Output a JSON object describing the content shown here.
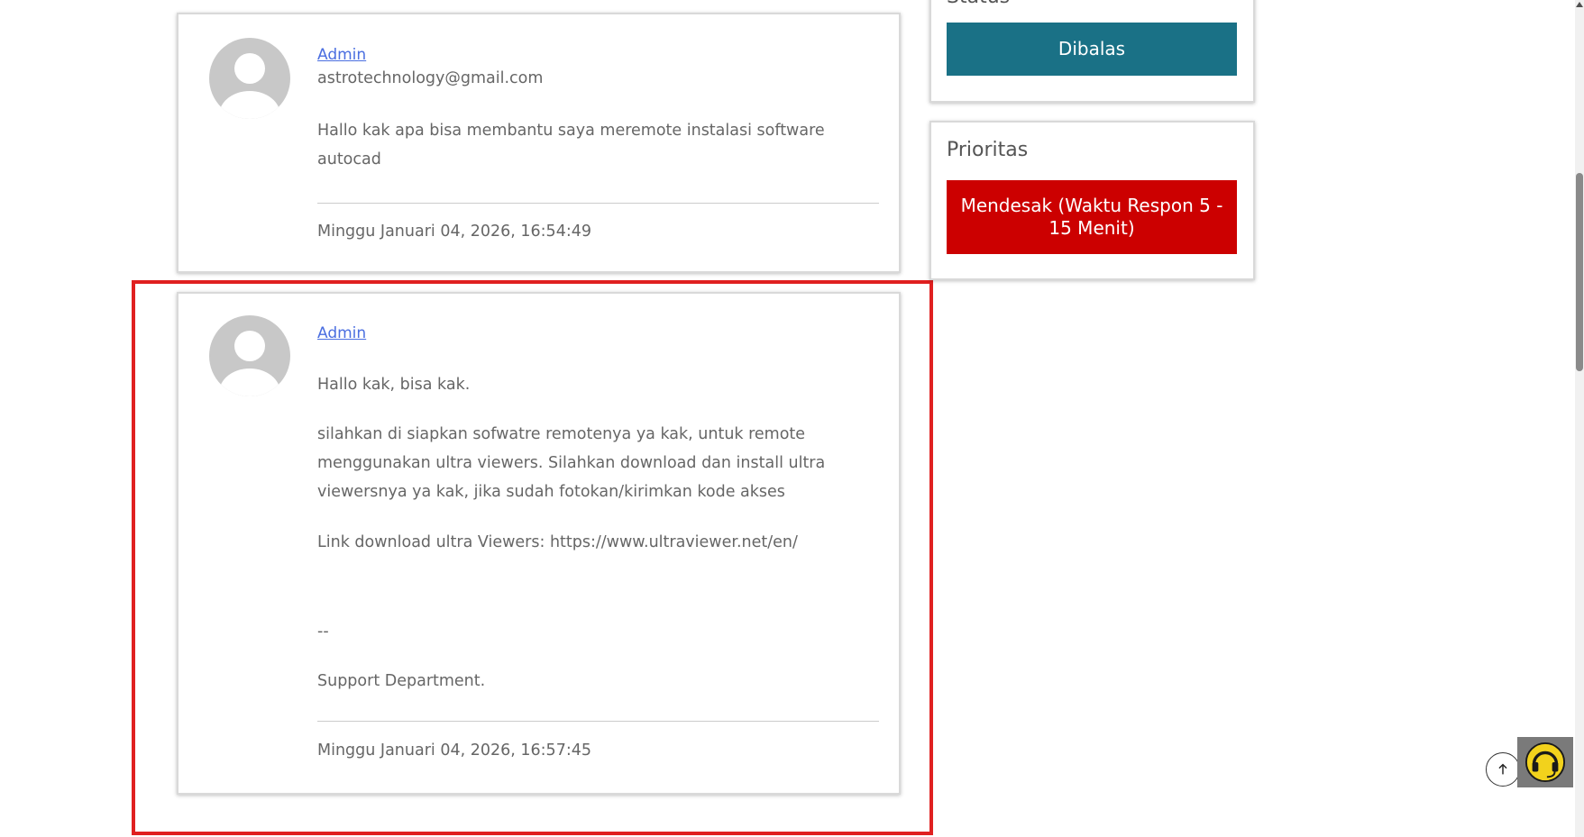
{
  "sidebar": {
    "status_title": "Status",
    "status_value": "Dibalas",
    "priority_title": "Prioritas",
    "priority_value": "Mendesak (Waktu Respon 5 - 15 Menit)"
  },
  "messages": [
    {
      "author": "Admin",
      "email": "astrotechnology@gmail.com",
      "paragraphs": [
        "Hallo kak apa bisa membantu saya meremote instalasi software autocad"
      ],
      "timestamp": "Minggu Januari 04, 2026, 16:54:49"
    },
    {
      "author": "Admin",
      "paragraphs": [
        "Hallo kak, bisa kak.",
        "silahkan di siapkan sofwatre remotenya ya kak, untuk remote menggunakan ultra viewers. Silahkan download dan install ultra viewersnya ya kak, jika sudah fotokan/kirimkan kode akses",
        "Link download ultra Viewers: https://www.ultraviewer.net/en/",
        "--",
        "Support Department."
      ],
      "timestamp": "Minggu Januari 04, 2026, 16:57:45"
    }
  ],
  "colors": {
    "status_badge": "#1a7186",
    "priority_badge": "#cc0000",
    "highlight_border": "#e02020",
    "link": "#4a6ee0"
  },
  "icons": {
    "avatar": "user-avatar-icon",
    "scroll_top": "arrow-up-icon",
    "support": "headset-icon"
  }
}
